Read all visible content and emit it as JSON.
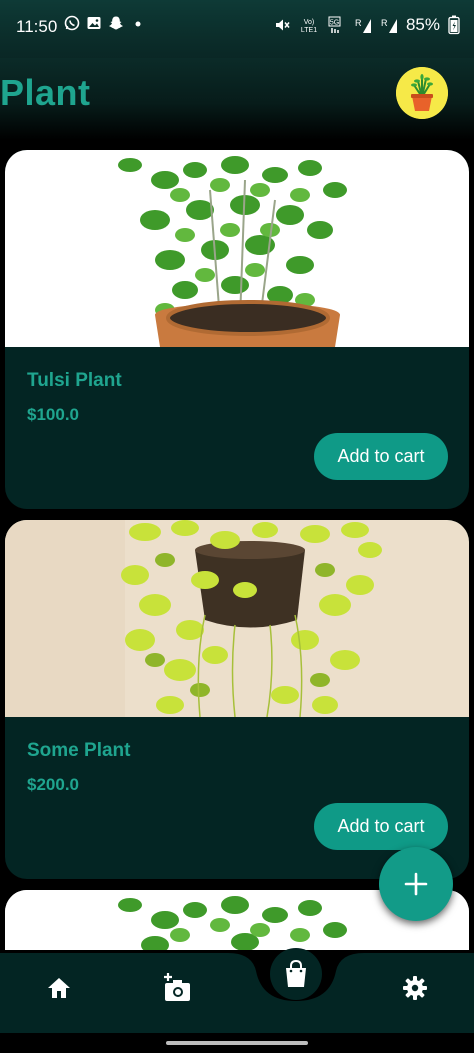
{
  "status_bar": {
    "time": "11:50",
    "battery_percent": "85%",
    "left_icons": [
      "whatsapp-icon",
      "gallery-icon",
      "snapchat-icon",
      "dot-icon"
    ],
    "right_icons": [
      "mute-icon",
      "volte-icon",
      "5g-signal-icon",
      "signal-r-icon",
      "signal-r2-icon",
      "battery-icon"
    ]
  },
  "header": {
    "title": "Plant"
  },
  "products": [
    {
      "name": "Tulsi Plant",
      "price": "$100.0",
      "button_label": "Add to cart",
      "image": "tulsi-plant-image"
    },
    {
      "name": "Some Plant",
      "price": "$200.0",
      "button_label": "Add to cart",
      "image": "hanging-pothos-image"
    }
  ],
  "fab": {
    "icon": "plus-icon"
  },
  "bottom_nav": {
    "items": [
      "home-icon",
      "add-photo-icon",
      "shopping-bag-icon",
      "settings-icon"
    ]
  },
  "colors": {
    "accent": "#1fa58f",
    "button": "#0f9a87",
    "card_bg": "#032523",
    "status_bar_bg": "#0e3a36"
  }
}
